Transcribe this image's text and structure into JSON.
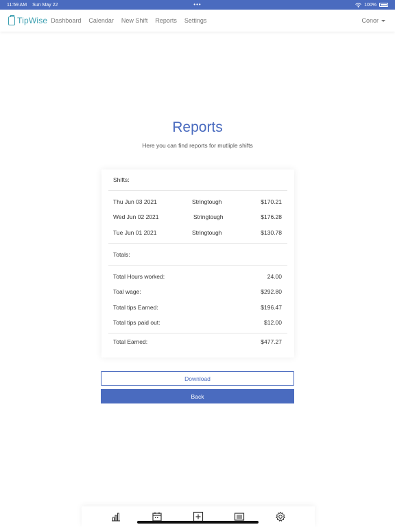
{
  "status_bar": {
    "time": "11:59 AM",
    "date": "Sun May 22",
    "dots": "•••",
    "battery": "100%"
  },
  "navbar": {
    "brand": "TipWise",
    "links": [
      "Dashboard",
      "Calendar",
      "New Shift",
      "Reports",
      "Settings"
    ],
    "user": "Conor"
  },
  "page": {
    "title": "Reports",
    "subtitle": "Here you can find reports for mutliple shifts"
  },
  "report": {
    "shifts_label": "Shifts:",
    "shifts": [
      {
        "date": "Thu Jun 03 2021",
        "employer": "Stringtough",
        "amount": "$170.21"
      },
      {
        "date": "Wed Jun 02 2021",
        "employer": "Stringtough",
        "amount": "$176.28"
      },
      {
        "date": "Tue Jun 01 2021",
        "employer": "Stringtough",
        "amount": "$130.78"
      }
    ],
    "totals_label": "Totals:",
    "totals": [
      {
        "label": "Total Hours worked:",
        "value": "24.00"
      },
      {
        "label": "Toal wage:",
        "value": "$292.80"
      },
      {
        "label": "Total tips Earned:",
        "value": "$196.47"
      },
      {
        "label": "Total tips paid out:",
        "value": "$12.00"
      }
    ],
    "earned": {
      "label": "Total Earned:",
      "value": "$477.27"
    }
  },
  "buttons": {
    "download": "Download",
    "back": "Back"
  },
  "tabbar": {
    "icons": [
      "bar-chart-icon",
      "calendar-icon",
      "plus-square-icon",
      "list-icon",
      "gear-icon"
    ]
  },
  "colors": {
    "accent": "#4a6bbf",
    "brand": "#3b9fb0"
  }
}
